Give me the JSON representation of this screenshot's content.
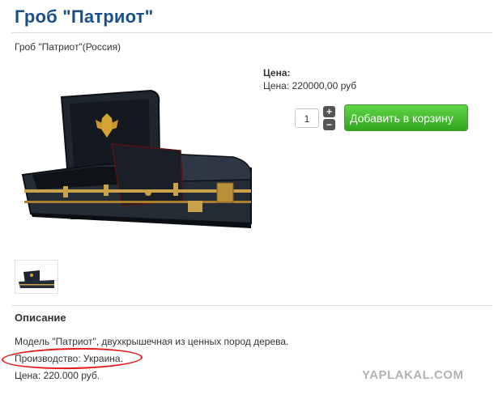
{
  "product": {
    "title": "Гроб \"Патриот\"",
    "subtitle": "Гроб \"Патриот\"(Россия)"
  },
  "price": {
    "label": "Цена:",
    "value": "Цена: 220000,00 руб"
  },
  "cart": {
    "quantity": "1",
    "plus_symbol": "+",
    "minus_symbol": "−",
    "add_button_label": "Добавить в корзину"
  },
  "description": {
    "heading": "Описание",
    "lines": [
      "Модель \"Патриот\", двухкрышечная из ценных пород дерева.",
      "Производство: Украина.",
      "Цена: 220.000 руб."
    ]
  },
  "watermark": "YAPLAKAL.COM",
  "colors": {
    "title": "#1b4f8a",
    "button_green": "#31a81f",
    "highlight_red": "#e41919",
    "casket_body": "#1f2630",
    "gold_trim": "#c9a24a"
  },
  "icons": [
    "russian-coat-of-arms-icon",
    "plus-icon",
    "minus-icon"
  ]
}
